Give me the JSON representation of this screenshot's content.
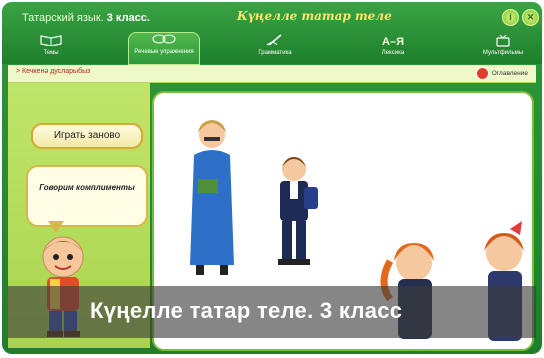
{
  "header": {
    "app_title": "Татарский язык.",
    "grade": "3 класс.",
    "logo_text": "Күңелле татар теле",
    "info_label": "i",
    "close_label": "✕"
  },
  "nav": {
    "items": [
      {
        "label": "Темы",
        "icon": "book-icon"
      },
      {
        "label": "Речевые упражнения",
        "icon": "speech-icon",
        "active": true
      },
      {
        "label": "Грамматика",
        "icon": "pen-icon"
      },
      {
        "label": "Лексика",
        "icon": "A–Я"
      },
      {
        "label": "Мультфильмы",
        "icon": "tv-icon"
      }
    ]
  },
  "breadcrumb": {
    "text": "> Кечкенә дусларыбыз"
  },
  "toc": {
    "label": "Оглавление"
  },
  "left_panel": {
    "replay_label": "Играть заново",
    "bubble_text": "Говорим комплименты"
  },
  "footer": {
    "text": "Күңелле татар теле. 3 класс"
  },
  "colors": {
    "header_green": "#2f9a3a",
    "panel_green": "#b3dc58",
    "accent_red": "#b22222"
  }
}
